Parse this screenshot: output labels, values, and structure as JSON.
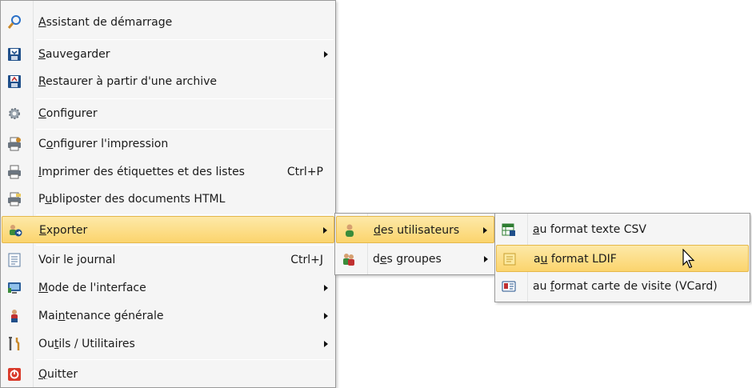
{
  "main_menu": {
    "items": [
      {
        "pre": "",
        "key": "A",
        "post": "ssistant de démarrage",
        "shortcut": "",
        "icon": "magic-wand-icon"
      },
      {
        "pre": "",
        "key": "S",
        "post": "auvegarder",
        "shortcut": "",
        "icon": "save-disk-icon"
      },
      {
        "pre": "",
        "key": "R",
        "post": "estaurer à partir d'une archive",
        "shortcut": "",
        "icon": "restore-disk-icon"
      },
      {
        "pre": "",
        "key": "C",
        "post": "onfigurer",
        "shortcut": "",
        "icon": "gear-icon"
      },
      {
        "pre": "C",
        "key": "o",
        "post": "nfigurer l'impression",
        "shortcut": "",
        "icon": "printer-settings-icon"
      },
      {
        "pre": "",
        "key": "I",
        "post": "mprimer des étiquettes et des listes",
        "shortcut": "Ctrl+P",
        "icon": "printer-icon"
      },
      {
        "pre": "P",
        "key": "u",
        "post": "bliposter des documents HTML",
        "shortcut": "",
        "icon": "mailmerge-printer-icon"
      },
      {
        "pre": "",
        "key": "E",
        "post": "xporter",
        "shortcut": "",
        "icon": "export-users-icon"
      },
      {
        "pre": "Voir le ",
        "key": "j",
        "post": "ournal",
        "shortcut": "Ctrl+J",
        "icon": "journal-icon"
      },
      {
        "pre": "",
        "key": "M",
        "post": "ode de l'interface",
        "shortcut": "",
        "icon": "monitor-icon"
      },
      {
        "pre": "Mai",
        "key": "n",
        "post": "tenance générale",
        "shortcut": "",
        "icon": "maintenance-user-icon"
      },
      {
        "pre": "Ou",
        "key": "t",
        "post": "ils / Utilitaires",
        "shortcut": "",
        "icon": "tools-icon"
      },
      {
        "pre": "",
        "key": "Q",
        "post": "uitter",
        "shortcut": "",
        "icon": "quit-icon"
      }
    ]
  },
  "export_submenu": {
    "items": [
      {
        "pre": "",
        "key": "d",
        "post": "es utilisateurs",
        "icon": "user-icon"
      },
      {
        "pre": "d",
        "key": "e",
        "post": "s groupes",
        "icon": "group-icon"
      }
    ]
  },
  "users_submenu": {
    "items": [
      {
        "pre": "",
        "key": "a",
        "post": "u format texte CSV",
        "icon": "csv-file-icon"
      },
      {
        "pre": "a",
        "key": "u",
        "post": " format LDIF",
        "icon": "ldif-file-icon"
      },
      {
        "pre": "au ",
        "key": "f",
        "post": "ormat carte de visite (VCard)",
        "icon": "vcard-icon"
      }
    ]
  },
  "colors": {
    "menu_bg": "#f5f5f5",
    "highlight_top": "#fde9a8",
    "highlight_bottom": "#fbd46d",
    "highlight_border": "#e5b84b"
  }
}
